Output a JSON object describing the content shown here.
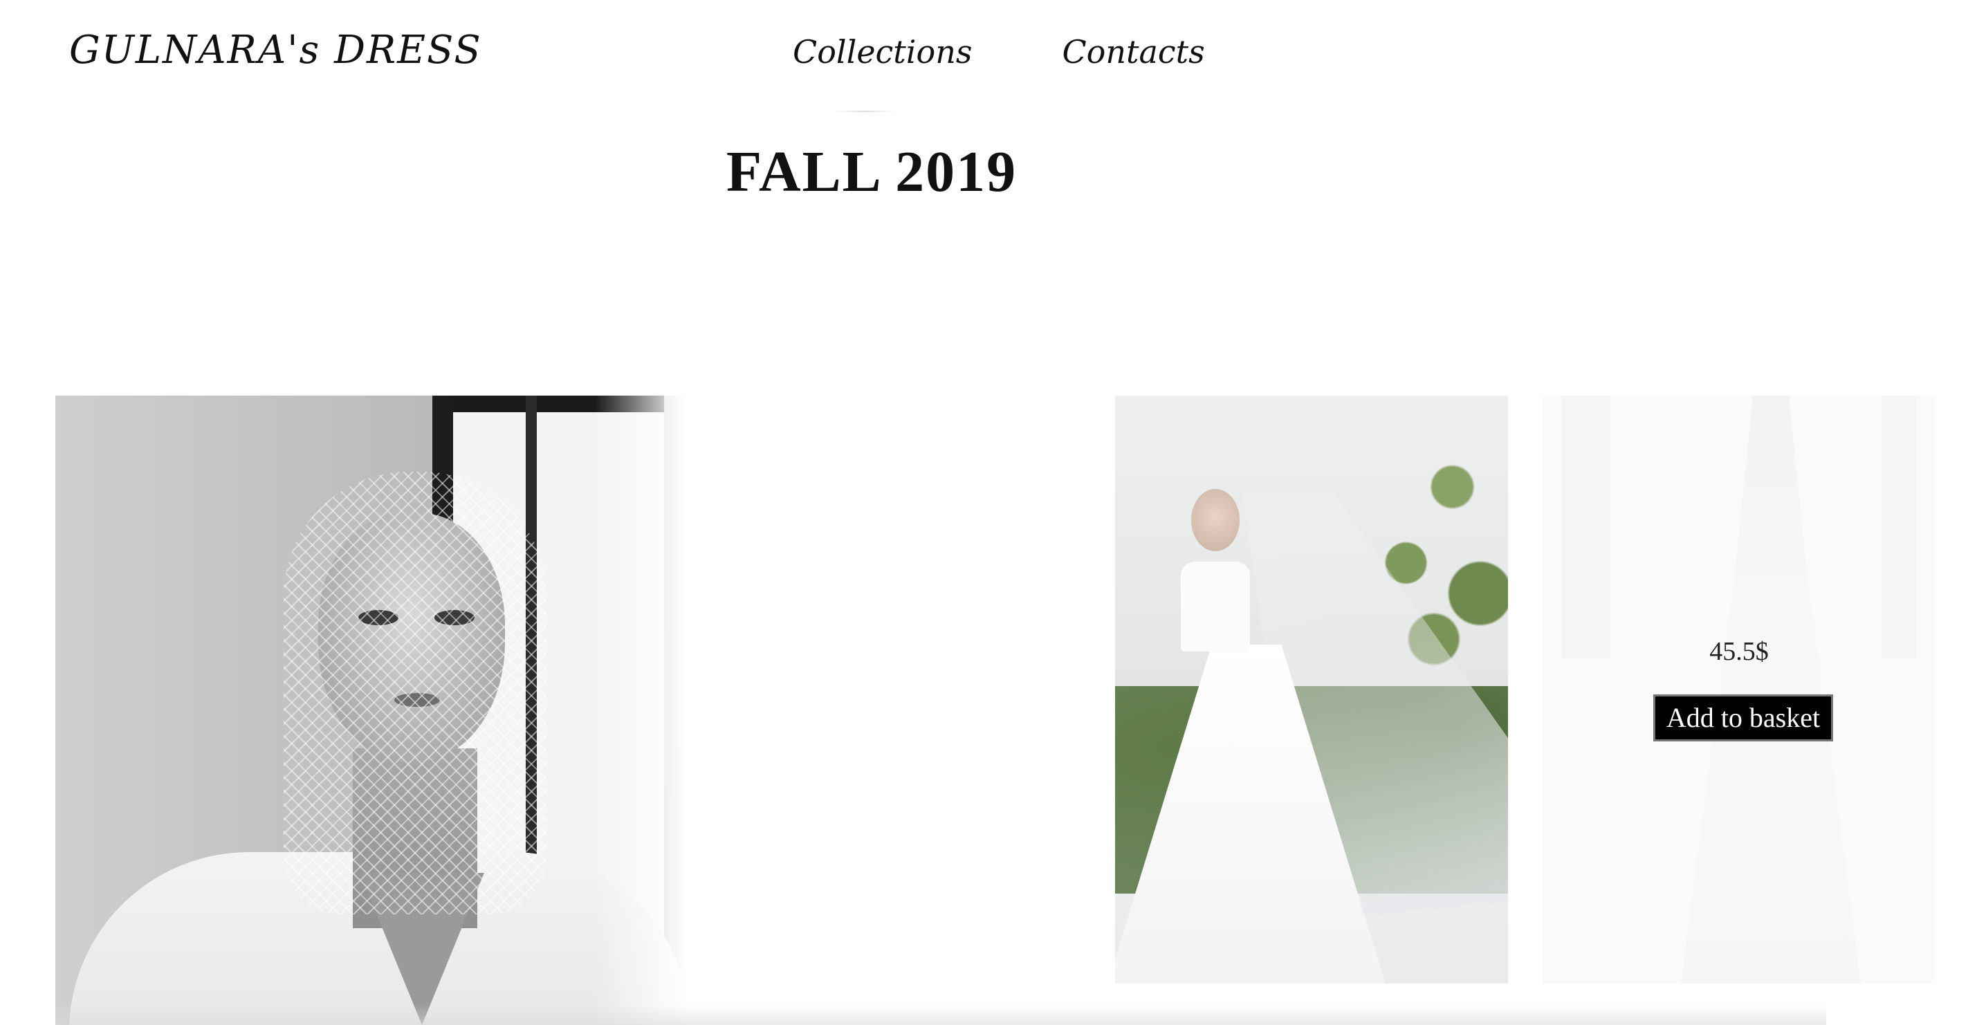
{
  "header": {
    "brand": "GULNARA's DRESS",
    "nav": {
      "collections": "Collections",
      "contacts": "Contacts"
    }
  },
  "main": {
    "title": "FALL 2019",
    "products": [
      {
        "image": "bride-veil-portrait"
      },
      {
        "image": "bride-outdoor-gown"
      },
      {
        "image": "bride-lace-gown",
        "price": "45.5$",
        "button": "Add to basket"
      }
    ]
  },
  "colors": {
    "background": "#ffffff",
    "text": "#111111",
    "button_bg": "#000000",
    "button_text": "#ffffff"
  }
}
